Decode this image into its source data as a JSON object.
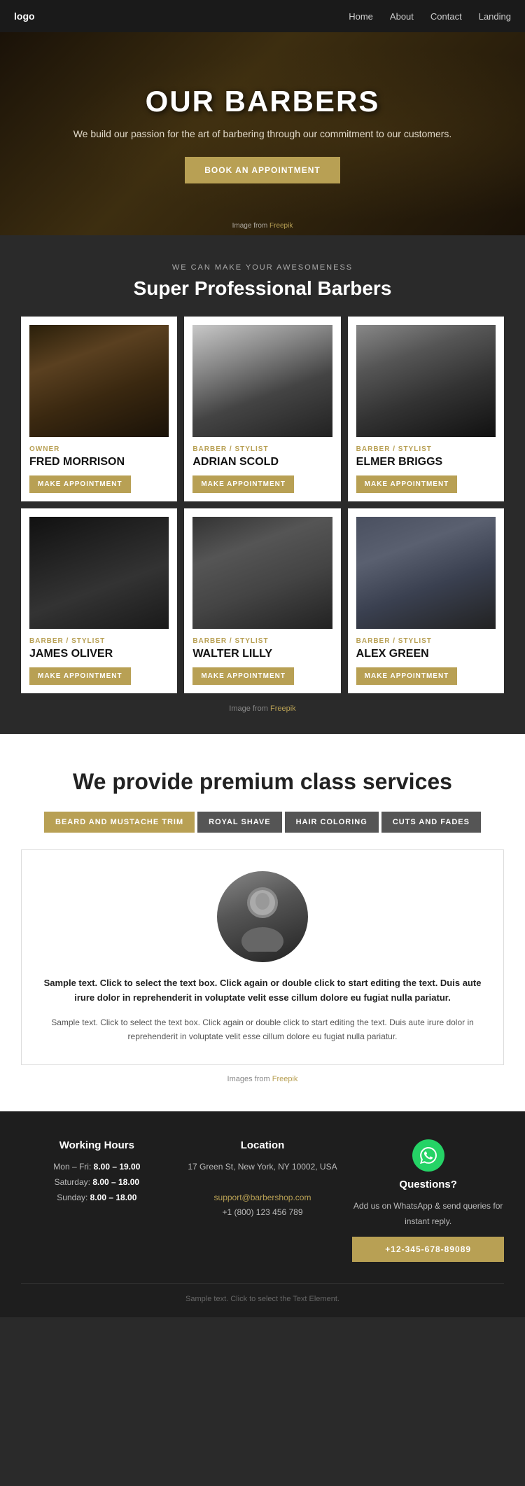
{
  "nav": {
    "logo": "logo",
    "links": [
      {
        "label": "Home",
        "name": "home-link"
      },
      {
        "label": "About",
        "name": "about-link"
      },
      {
        "label": "Contact",
        "name": "contact-link"
      },
      {
        "label": "Landing",
        "name": "landing-link"
      }
    ]
  },
  "hero": {
    "title": "OUR BARBERS",
    "subtitle": "We build our passion for the art of barbering through our commitment to our customers.",
    "cta_button": "BOOK AN APPOINTMENT",
    "image_credit": "Image from",
    "image_credit_link": "Freepik"
  },
  "barbers_section": {
    "subtitle": "WE CAN MAKE YOUR AWESOMENESS",
    "title": "Super Professional Barbers",
    "image_credit": "Image from",
    "image_credit_link": "Freepik",
    "barbers": [
      {
        "role": "OWNER",
        "name": "FRED MORRISON",
        "photo_class": "photo-fred",
        "btn": "MAKE APPOINTMENT"
      },
      {
        "role": "BARBER / STYLIST",
        "name": "ADRIAN SCOLD",
        "photo_class": "photo-adrian",
        "btn": "MAKE APPOINTMENT"
      },
      {
        "role": "BARBER / STYLIST",
        "name": "ELMER BRIGGS",
        "photo_class": "photo-elmer",
        "btn": "MAKE APPOINTMENT"
      },
      {
        "role": "BARBER / STYLIST",
        "name": "JAMES OLIVER",
        "photo_class": "photo-james",
        "btn": "MAKE APPOINTMENT"
      },
      {
        "role": "BARBER / STYLIST",
        "name": "WALTER LILLY",
        "photo_class": "photo-walter",
        "btn": "MAKE APPOINTMENT"
      },
      {
        "role": "BARBER / STYLIST",
        "name": "ALEX GREEN",
        "photo_class": "photo-alex",
        "btn": "MAKE APPOINTMENT"
      }
    ]
  },
  "services_section": {
    "title": "We provide premium class services",
    "tabs": [
      {
        "label": "BEARD AND MUSTACHE TRIM",
        "active": true
      },
      {
        "label": "ROYAL SHAVE",
        "active": false
      },
      {
        "label": "HAIR COLORING",
        "active": false
      },
      {
        "label": "CUTS AND FADES",
        "active": false
      }
    ],
    "service_text_bold": "Sample text. Click to select the text box. Click again or double click to start editing the text. Duis aute irure dolor in reprehenderit in voluptate velit esse cillum dolore eu fugiat nulla pariatur.",
    "service_text_normal": "Sample text. Click to select the text box. Click again or double click to start editing the text. Duis aute irure dolor in reprehenderit in voluptate velit esse cillum dolore eu fugiat nulla pariatur.",
    "image_credit": "Images from",
    "image_credit_link": "Freepik"
  },
  "footer": {
    "working_hours": {
      "title": "Working Hours",
      "mon_fri_label": "Mon – Fri:",
      "mon_fri_hours": "8.00 – 19.00",
      "saturday_label": "Saturday:",
      "saturday_hours": "8.00 – 18.00",
      "sunday_label": "Sunday:",
      "sunday_hours": "8.00 – 18.00"
    },
    "location": {
      "title": "Location",
      "address": "17 Green St, New York, NY 10002, USA",
      "email": "support@barbershop.com",
      "phone": "+1 (800) 123 456 789"
    },
    "questions": {
      "title": "Questions?",
      "text": "Add us on WhatsApp & send queries for instant reply.",
      "phone_btn": "+12-345-678-89089"
    },
    "bottom_text": "Sample text. Click to select the Text Element."
  }
}
